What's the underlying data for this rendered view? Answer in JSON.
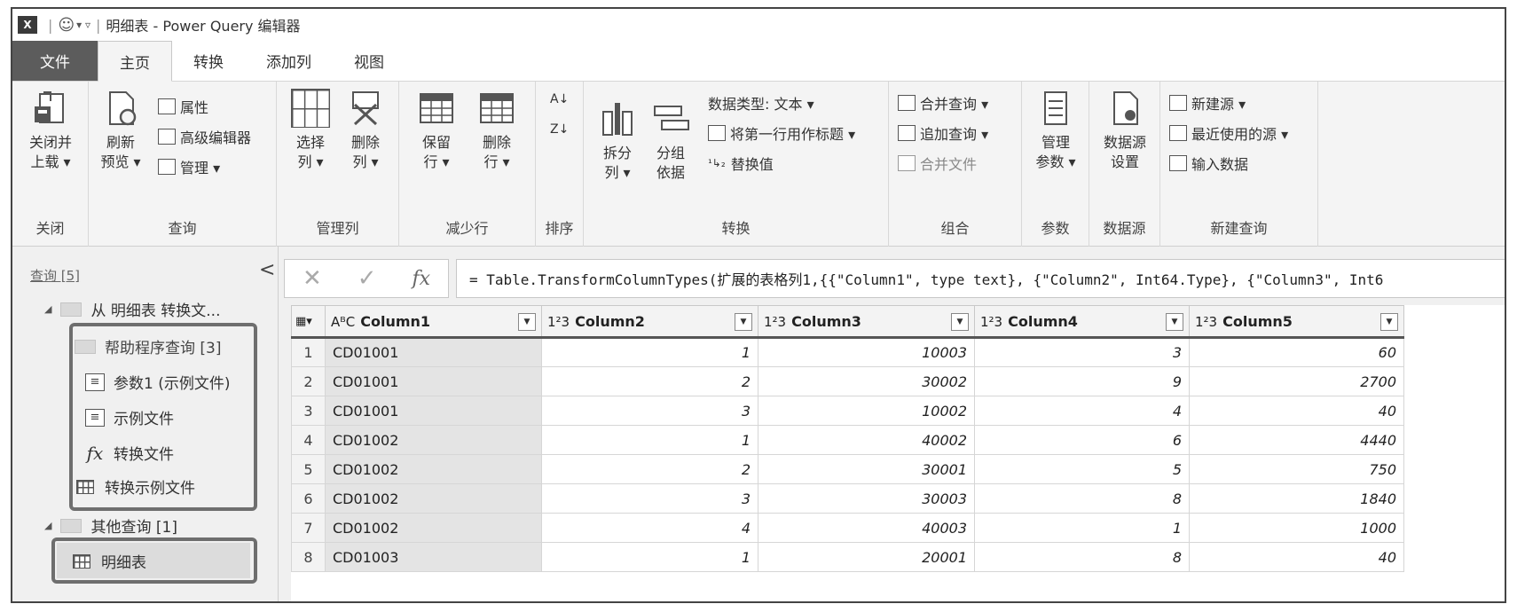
{
  "window": {
    "logo": "X",
    "title": "明细表 - Power Query 编辑器"
  },
  "tabs": [
    "文件",
    "主页",
    "转换",
    "添加列",
    "视图"
  ],
  "ribbon": {
    "close": {
      "btn1": "关闭并",
      "btn2": "上载 ▾",
      "label": "关闭"
    },
    "query": {
      "refresh1": "刷新",
      "refresh2": "预览 ▾",
      "properties": "属性",
      "advanced": "高级编辑器",
      "manage": "管理 ▾",
      "label": "查询"
    },
    "manage_cols": {
      "select1": "选择",
      "select2": "列 ▾",
      "remove1": "删除",
      "remove2": "列 ▾",
      "label": "管理列"
    },
    "reduce_rows": {
      "keep1": "保留",
      "keep2": "行 ▾",
      "remove1": "删除",
      "remove2": "行 ▾",
      "label": "减少行"
    },
    "sort": {
      "label": "排序"
    },
    "transform": {
      "split1": "拆分",
      "split2": "列 ▾",
      "group1": "分组",
      "group2": "依据",
      "datatype": "数据类型: 文本 ▾",
      "firstrow": "将第一行用作标题 ▾",
      "replace": "替换值",
      "label": "转换"
    },
    "combine": {
      "merge": "合并查询 ▾",
      "append": "追加查询 ▾",
      "combine_files": "合并文件",
      "label": "组合"
    },
    "params": {
      "manage1": "管理",
      "manage2": "参数 ▾",
      "label": "参数"
    },
    "datasource": {
      "settings1": "数据源",
      "settings2": "设置",
      "label": "数据源"
    },
    "newquery": {
      "newsource": "新建源 ▾",
      "recent": "最近使用的源 ▾",
      "enter": "输入数据",
      "label": "新建查询"
    }
  },
  "queries": {
    "header": "查询 [5]",
    "collapse": "<",
    "group1": "从 明细表 转换文...",
    "helper": "帮助程序查询 [3]",
    "param": "参数1 (示例文件)",
    "sample": "示例文件",
    "transform_file": "转换文件",
    "transform_sample": "转换示例文件",
    "others": "其他查询 [1]",
    "detail": "明细表"
  },
  "formula": "= Table.TransformColumnTypes(扩展的表格列1,{{\"Column1\", type text}, {\"Column2\", Int64.Type}, {\"Column3\", Int6",
  "table": {
    "columns": [
      {
        "type": "AᴮC",
        "name": "Column1"
      },
      {
        "type": "1²3",
        "name": "Column2"
      },
      {
        "type": "1²3",
        "name": "Column3"
      },
      {
        "type": "1²3",
        "name": "Column4"
      },
      {
        "type": "1²3",
        "name": "Column5"
      }
    ],
    "rows": [
      [
        "1",
        "CD01001",
        "1",
        "10003",
        "3",
        "60"
      ],
      [
        "2",
        "CD01001",
        "2",
        "30002",
        "9",
        "2700"
      ],
      [
        "3",
        "CD01001",
        "3",
        "10002",
        "4",
        "40"
      ],
      [
        "4",
        "CD01002",
        "1",
        "40002",
        "6",
        "4440"
      ],
      [
        "5",
        "CD01002",
        "2",
        "30001",
        "5",
        "750"
      ],
      [
        "6",
        "CD01002",
        "3",
        "30003",
        "8",
        "1840"
      ],
      [
        "7",
        "CD01002",
        "4",
        "40003",
        "1",
        "1000"
      ],
      [
        "8",
        "CD01003",
        "1",
        "20001",
        "8",
        "40"
      ]
    ]
  }
}
